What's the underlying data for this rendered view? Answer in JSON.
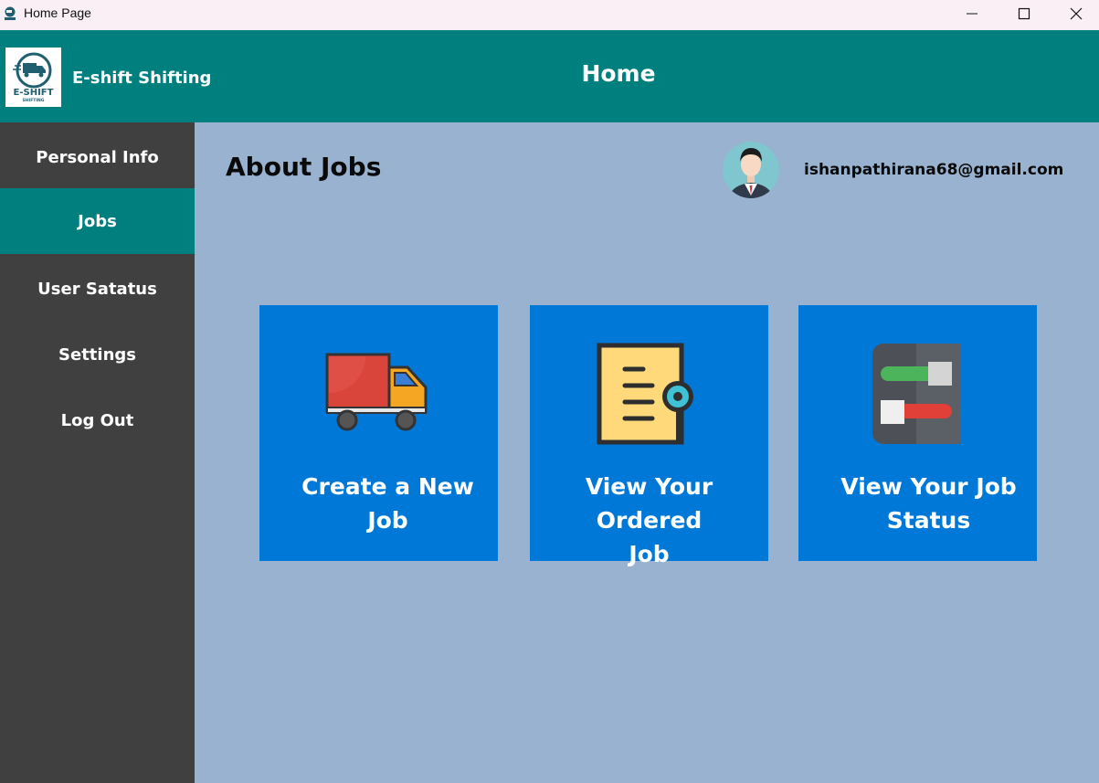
{
  "window": {
    "title": "Home Page"
  },
  "header": {
    "brand": "E-shift Shifting",
    "title": "Home",
    "logo_text_top": "E-SHIFT",
    "logo_text_bottom": "SHIFTING"
  },
  "sidebar": {
    "items": [
      {
        "label": "Personal Info",
        "active": false
      },
      {
        "label": "Jobs",
        "active": true
      },
      {
        "label": "User Satatus",
        "active": false
      },
      {
        "label": "Settings",
        "active": false
      },
      {
        "label": "Log Out",
        "active": false
      }
    ]
  },
  "main": {
    "page_title": "About Jobs",
    "user_email": "ishanpathirana68@gmail.com",
    "cards": [
      {
        "label_line1": "Create a New",
        "label_line2": "Job",
        "icon": "truck-icon"
      },
      {
        "label_line1": "View Your Ordered",
        "label_line2": "Job",
        "icon": "document-search-icon"
      },
      {
        "label_line1": "View Your Job",
        "label_line2": "Status",
        "icon": "toggle-switches-icon"
      }
    ]
  },
  "colors": {
    "header_bg": "#007f7f",
    "sidebar_bg": "#404040",
    "sidebar_active": "#007f7f",
    "main_bg": "#98b2d0",
    "card_bg": "#0078d7"
  }
}
